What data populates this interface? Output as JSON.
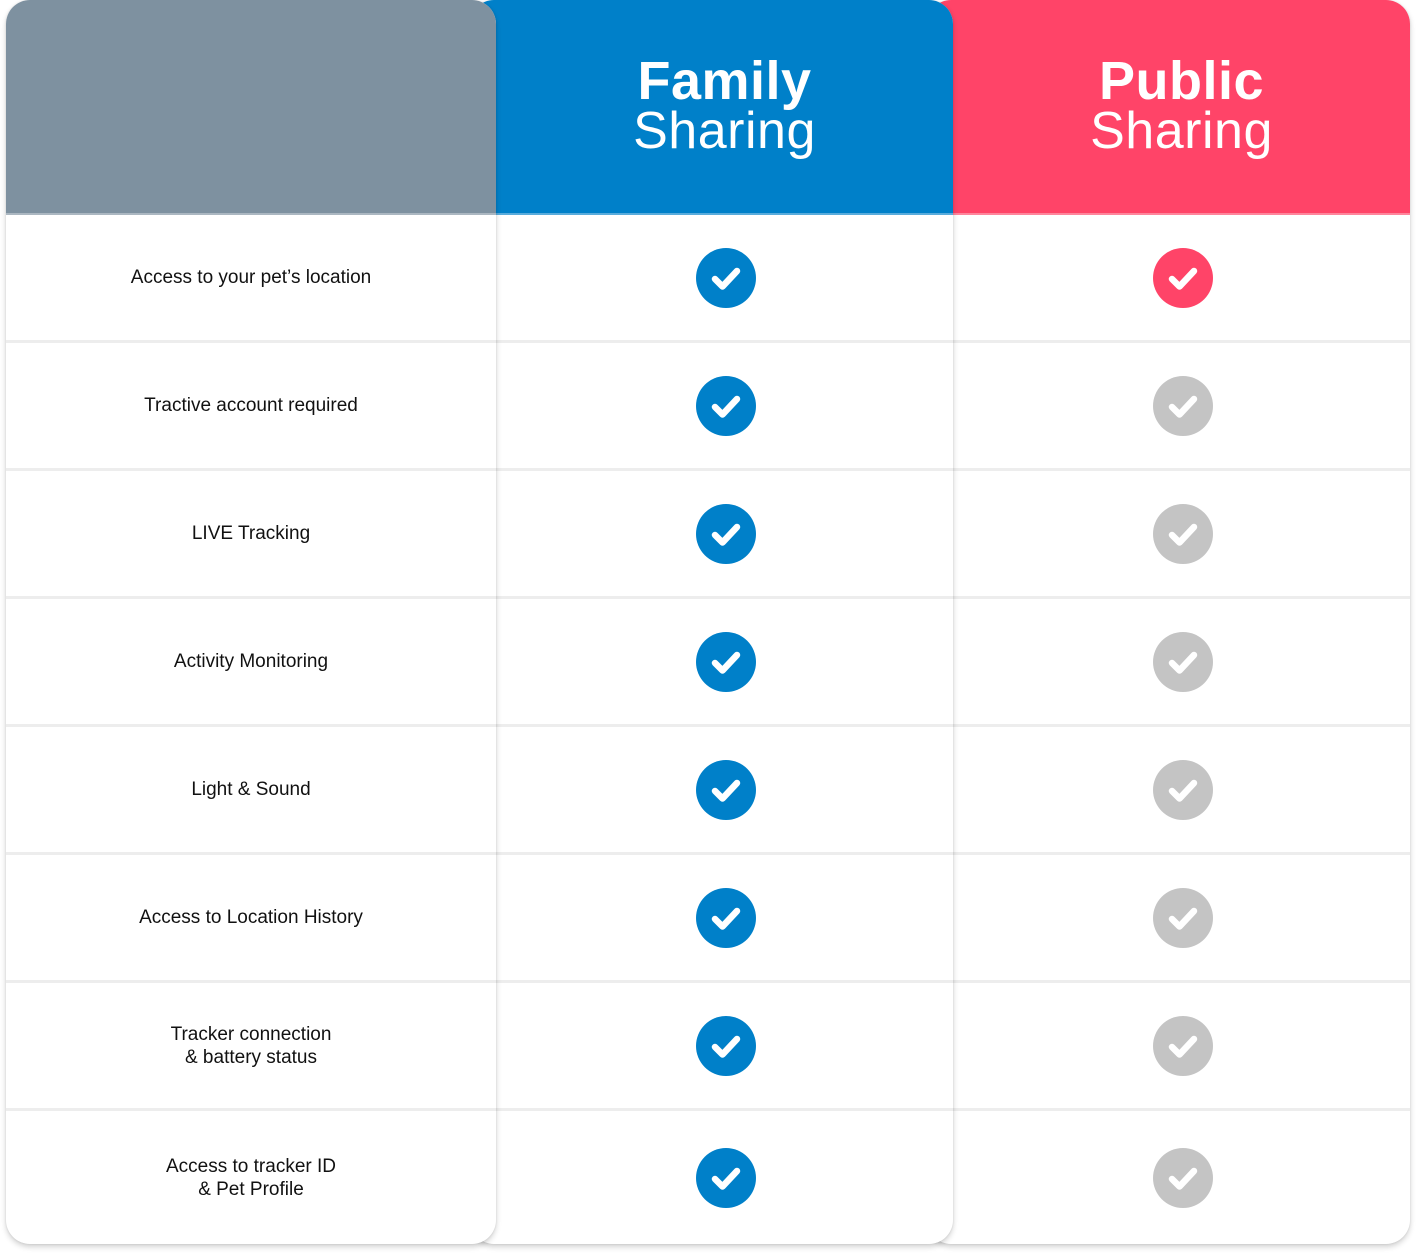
{
  "colors": {
    "feature_header": "#7e91a0",
    "family": "#0080c9",
    "public": "#ff4468",
    "unavailable": "#c4c4c4",
    "divider": "#ededed"
  },
  "columns": {
    "feature": {
      "title": "",
      "subtitle": ""
    },
    "family": {
      "title": "Family",
      "subtitle": "Sharing"
    },
    "public": {
      "title": "Public",
      "subtitle": "Sharing"
    }
  },
  "rows": [
    {
      "feature": "Access to your pet’s location",
      "family": "check-circle-icon",
      "family_state": "included",
      "public": "check-circle-icon",
      "public_state": "included"
    },
    {
      "feature": "Tractive account required",
      "family": "check-circle-icon",
      "family_state": "included",
      "public": "check-circle-icon",
      "public_state": "not-included"
    },
    {
      "feature": "LIVE Tracking",
      "family": "check-circle-icon",
      "family_state": "included",
      "public": "check-circle-icon",
      "public_state": "not-included"
    },
    {
      "feature": "Activity Monitoring",
      "family": "check-circle-icon",
      "family_state": "included",
      "public": "check-circle-icon",
      "public_state": "not-included"
    },
    {
      "feature": "Light & Sound",
      "family": "check-circle-icon",
      "family_state": "included",
      "public": "check-circle-icon",
      "public_state": "not-included"
    },
    {
      "feature": "Access to Location History",
      "family": "check-circle-icon",
      "family_state": "included",
      "public": "check-circle-icon",
      "public_state": "not-included"
    },
    {
      "feature": "Tracker connection\n& battery status",
      "family": "check-circle-icon",
      "family_state": "included",
      "public": "check-circle-icon",
      "public_state": "not-included"
    },
    {
      "feature": "Access to tracker ID\n& Pet Profile",
      "family": "check-circle-icon",
      "family_state": "included",
      "public": "check-circle-icon",
      "public_state": "not-included"
    }
  ]
}
